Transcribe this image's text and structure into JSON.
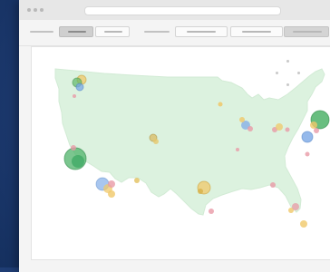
{
  "window": {
    "title_dots": [
      "close",
      "minimize",
      "maximize"
    ],
    "url": ""
  },
  "toolbar": {
    "items": [
      "menu-line",
      "tab-active",
      "tab",
      "menu-line",
      "field",
      "field",
      "button"
    ]
  },
  "map": {
    "land_color": "#dcf2df",
    "markers": [
      {
        "name": "seattle",
        "colors": [
          "#f0c869",
          "#5fb86a"
        ]
      },
      {
        "name": "portland",
        "colors": [
          "#7aa7e6"
        ]
      },
      {
        "name": "oregon-small",
        "colors": [
          "#e89aa6"
        ]
      },
      {
        "name": "san-francisco",
        "colors": [
          "#4fb36a",
          "#39a760"
        ]
      },
      {
        "name": "los-angeles",
        "colors": [
          "#e8a0a8",
          "#f0c869",
          "#7aa7e6"
        ]
      },
      {
        "name": "san-diego",
        "colors": [
          "#f0c869"
        ]
      },
      {
        "name": "phoenix",
        "colors": [
          "#e2c05e"
        ]
      },
      {
        "name": "denver",
        "colors": [
          "#d9be6a"
        ]
      },
      {
        "name": "kansas",
        "colors": [
          "#e89aa6"
        ]
      },
      {
        "name": "minneapolis",
        "colors": [
          "#f0c869"
        ]
      },
      {
        "name": "chicago",
        "colors": [
          "#e89aa6",
          "#f0c869",
          "#7aa7e6"
        ]
      },
      {
        "name": "dallas",
        "colors": [
          "#f0c869"
        ]
      },
      {
        "name": "houston",
        "colors": [
          "#e89aa6"
        ]
      },
      {
        "name": "atlanta",
        "colors": [
          "#e89aa6"
        ]
      },
      {
        "name": "pittsburgh",
        "colors": [
          "#e89aa6",
          "#f0c869"
        ]
      },
      {
        "name": "boston",
        "colors": [
          "#4fb36a"
        ]
      },
      {
        "name": "new-york",
        "colors": [
          "#4fb36a",
          "#f0c869"
        ]
      },
      {
        "name": "washington",
        "colors": [
          "#7aa7e6"
        ]
      },
      {
        "name": "raleigh",
        "colors": [
          "#e89aa6"
        ]
      },
      {
        "name": "jacksonville",
        "colors": [
          "#f0c869"
        ]
      },
      {
        "name": "orlando",
        "colors": [
          "#e89aa6"
        ]
      },
      {
        "name": "miami",
        "colors": [
          "#f0c869"
        ]
      }
    ]
  }
}
